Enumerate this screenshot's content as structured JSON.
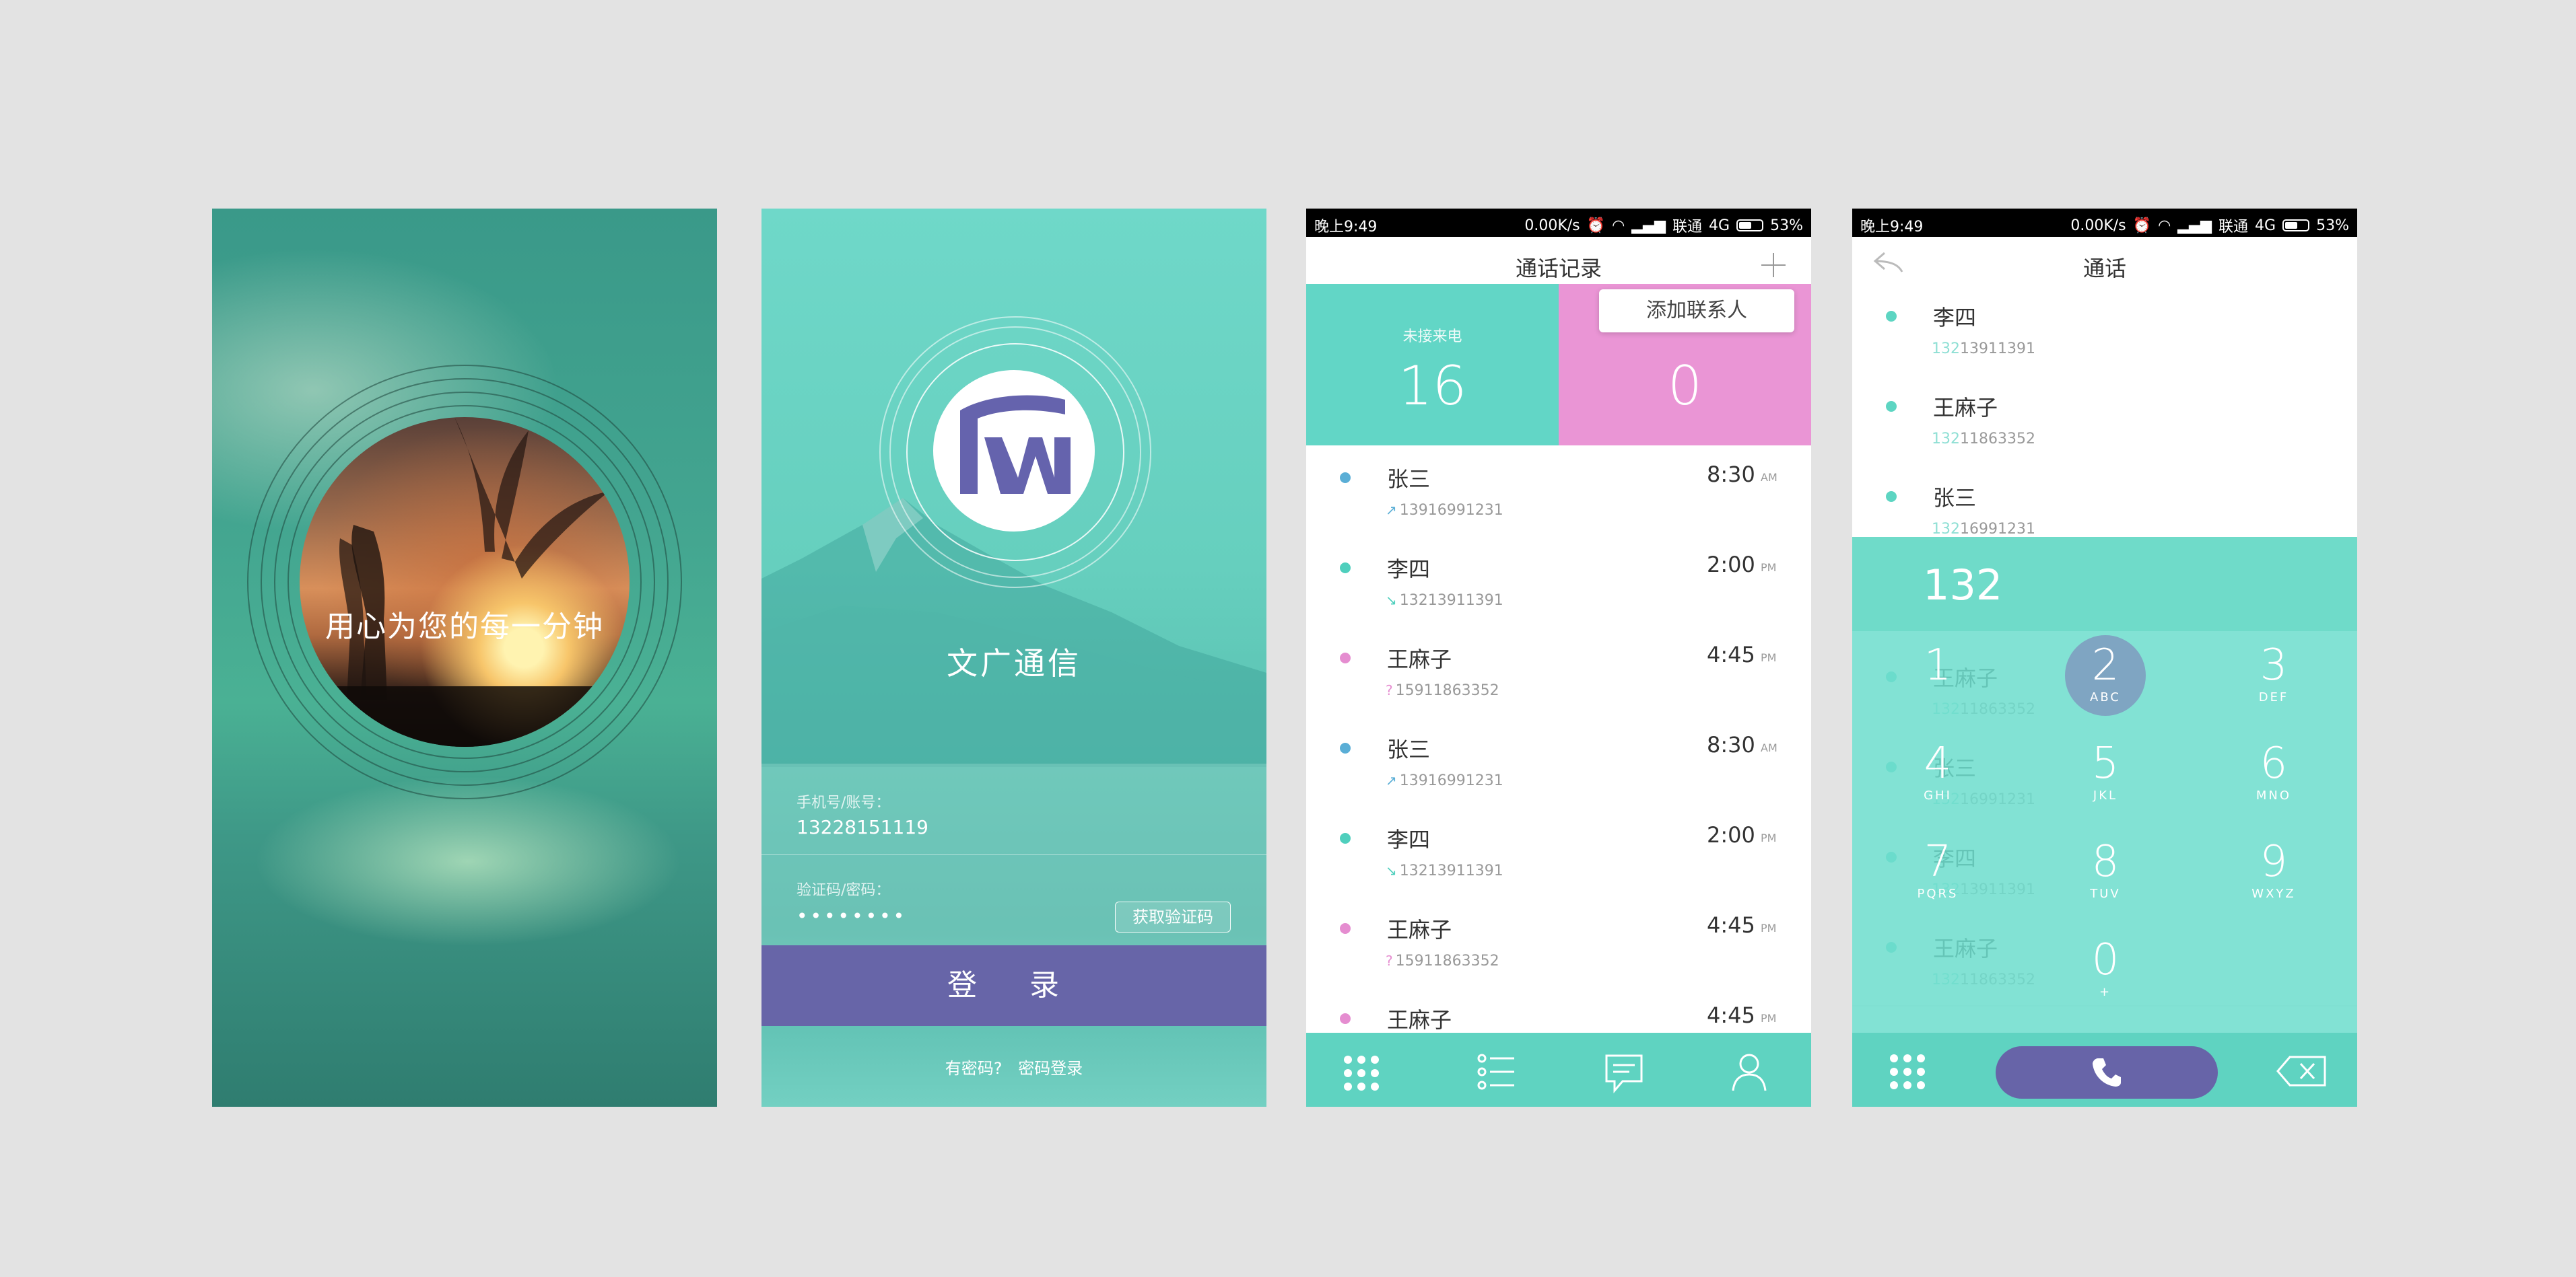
{
  "splash": {
    "tagline": "用心为您的每一分钟",
    "brand_name": "文广"
  },
  "login": {
    "app_name": "文广通信",
    "phone_label": "手机号/账号：",
    "phone_value": "13228151119",
    "code_label": "验证码/密码：",
    "code_value": "••••••••",
    "get_code_button": "获取验证码",
    "login_button": "登 录",
    "have_password": "有密码?",
    "password_login": "密码登录"
  },
  "status_bar": {
    "time": "晚上9:49",
    "speed": "0.00K/s",
    "carrier": "联通",
    "network": "4G",
    "battery": "53%"
  },
  "call_log": {
    "title": "通话记录",
    "missed_label": "未接来电",
    "missed_count": "16",
    "unread_count": "0",
    "popup_label": "添加联系人",
    "rows": [
      {
        "name": "张三",
        "number": "13916991231",
        "direction": "out",
        "time": "8:30",
        "ampm": "AM",
        "color": "#5aaed6"
      },
      {
        "name": "李四",
        "number": "13213911391",
        "direction": "in",
        "time": "2:00",
        "ampm": "PM",
        "color": "#4fcfbd"
      },
      {
        "name": "王麻子",
        "number": "15911863352",
        "direction": "missed",
        "time": "4:45",
        "ampm": "PM",
        "color": "#e58dd0"
      },
      {
        "name": "张三",
        "number": "13916991231",
        "direction": "out",
        "time": "8:30",
        "ampm": "AM",
        "color": "#5aaed6"
      },
      {
        "name": "李四",
        "number": "13213911391",
        "direction": "in",
        "time": "2:00",
        "ampm": "PM",
        "color": "#4fcfbd"
      },
      {
        "name": "王麻子",
        "number": "15911863352",
        "direction": "missed",
        "time": "4:45",
        "ampm": "PM",
        "color": "#e58dd0"
      },
      {
        "name": "王麻子",
        "number": "",
        "direction": "missed",
        "time": "4:45",
        "ampm": "PM",
        "color": "#e58dd0"
      }
    ],
    "tabs": [
      "keypad-icon",
      "list-icon",
      "message-icon",
      "contact-icon"
    ]
  },
  "dialer": {
    "title": "通话",
    "input": "132",
    "contacts": [
      {
        "name": "李四",
        "prefix": "132",
        "rest": "13911391"
      },
      {
        "name": "王麻子",
        "prefix": "132",
        "rest": "11863352"
      },
      {
        "name": "张三",
        "prefix": "132",
        "rest": "16991231"
      },
      {
        "name": "李四",
        "prefix": "132",
        "rest": "13911391"
      },
      {
        "name": "王麻子",
        "prefix": "132",
        "rest": "11863352"
      },
      {
        "name": "张三",
        "prefix": "132",
        "rest": "16991231"
      },
      {
        "name": "李四",
        "prefix": "132",
        "rest": "13911391"
      },
      {
        "name": "王麻子",
        "prefix": "132",
        "rest": "11863352"
      }
    ],
    "keys": [
      {
        "digit": "1",
        "letters": ""
      },
      {
        "digit": "2",
        "letters": "ABC"
      },
      {
        "digit": "3",
        "letters": "DEF"
      },
      {
        "digit": "4",
        "letters": "GHI"
      },
      {
        "digit": "5",
        "letters": "JKL"
      },
      {
        "digit": "6",
        "letters": "MNO"
      },
      {
        "digit": "7",
        "letters": "PQRS"
      },
      {
        "digit": "8",
        "letters": "TUV"
      },
      {
        "digit": "9",
        "letters": "WXYZ"
      },
      {
        "digit": "0",
        "letters": "+"
      }
    ],
    "active_key": "2"
  },
  "colors": {
    "accent_teal": "#62d6c6",
    "accent_pink": "#ea95d5",
    "accent_purple": "#6765a8"
  }
}
